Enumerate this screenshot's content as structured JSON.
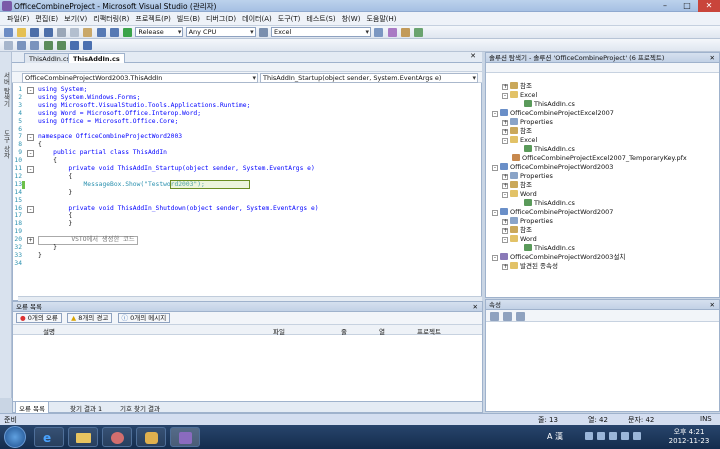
{
  "window": {
    "title": "OfficeCombineProject - Microsoft Visual Studio (관리자)"
  },
  "menu": [
    "파일(F)",
    "편집(E)",
    "보기(V)",
    "리팩터링(R)",
    "프로젝트(P)",
    "빌드(B)",
    "디버그(D)",
    "데이터(A)",
    "도구(T)",
    "테스트(S)",
    "창(W)",
    "도움말(H)"
  ],
  "toolbar": {
    "config": "Release",
    "platform": "Any CPU",
    "find_combo": "Excel"
  },
  "side_tabs": [
    "서버 탐색기",
    "도구 상자"
  ],
  "doc_tabs": [
    "ThisAddIn.cs*",
    "ThisAddIn.cs"
  ],
  "nav": {
    "left": "OfficeCombineProjectWord2003.ThisAddIn",
    "right": "ThisAddIn_Startup(object sender, System.EventArgs e)"
  },
  "code_lines": [
    {
      "n": "1",
      "text": "using System;"
    },
    {
      "n": "2",
      "text": "using System.Windows.Forms;"
    },
    {
      "n": "3",
      "text": "using Microsoft.VisualStudio.Tools.Applications.Runtime;"
    },
    {
      "n": "4",
      "text": "using Word = Microsoft.Office.Interop.Word;"
    },
    {
      "n": "5",
      "text": "using Office = Microsoft.Office.Core;"
    },
    {
      "n": "6",
      "text": ""
    },
    {
      "n": "7",
      "text": "namespace OfficeCombineProjectWord2003"
    },
    {
      "n": "8",
      "text": "{"
    },
    {
      "n": "9",
      "text": "    public partial class ThisAddIn"
    },
    {
      "n": "10",
      "text": "    {"
    },
    {
      "n": "11",
      "text": "        private void ThisAddIn_Startup(object sender, System.EventArgs e)"
    },
    {
      "n": "12",
      "text": "        {"
    },
    {
      "n": "13",
      "text": "            MessageBox.Show(\"Testword2003\");"
    },
    {
      "n": "14",
      "text": "        }"
    },
    {
      "n": "15",
      "text": ""
    },
    {
      "n": "16",
      "text": "        private void ThisAddIn_Shutdown(object sender, System.EventArgs e)"
    },
    {
      "n": "17",
      "text": "        {"
    },
    {
      "n": "18",
      "text": "        }"
    },
    {
      "n": "19",
      "text": ""
    },
    {
      "n": "20",
      "text": "        VSTO에서 생성한 코드"
    },
    {
      "n": "32",
      "text": "    }"
    },
    {
      "n": "33",
      "text": "}"
    },
    {
      "n": "34",
      "text": ""
    }
  ],
  "solution_explorer": {
    "title": "솔루션 탐색기 - 솔루션 'OfficeCombineProject' (6 프로젝트)",
    "items": [
      "참조",
      "Excel",
      "ThisAddIn.cs",
      "OfficeCombineProjectExcel2007",
      "Properties",
      "참조",
      "Excel",
      "ThisAddIn.cs",
      "OfficeCombineProjectExcel2007_TemporaryKey.pfx",
      "OfficeCombineProjectWord2003",
      "Properties",
      "참조",
      "Word",
      "ThisAddIn.cs",
      "OfficeCombineProjectWord2007",
      "Properties",
      "참조",
      "Word",
      "ThisAddIn.cs",
      "OfficeCombineProjectWord2003설치",
      "발견된 종속성"
    ]
  },
  "properties": {
    "title": "속성"
  },
  "errors": {
    "title": "오류 목록",
    "errors_btn": "0개의 오류",
    "warnings_btn": "8개의 경고",
    "messages_btn": "0개의 메시지",
    "columns": [
      "설명",
      "파일",
      "줄",
      "열",
      "프로젝트"
    ],
    "bottom_tabs": [
      "오류 목록",
      "찾기 결과 1",
      "기호 찾기 결과"
    ]
  },
  "status": {
    "left": "준비",
    "line": "줄: 13",
    "col": "열: 42",
    "ch": "문자: 42",
    "mode": "INS"
  },
  "taskbar": {
    "time": "오후 4:21",
    "date": "2012-11-23",
    "ime": "A 漢"
  }
}
